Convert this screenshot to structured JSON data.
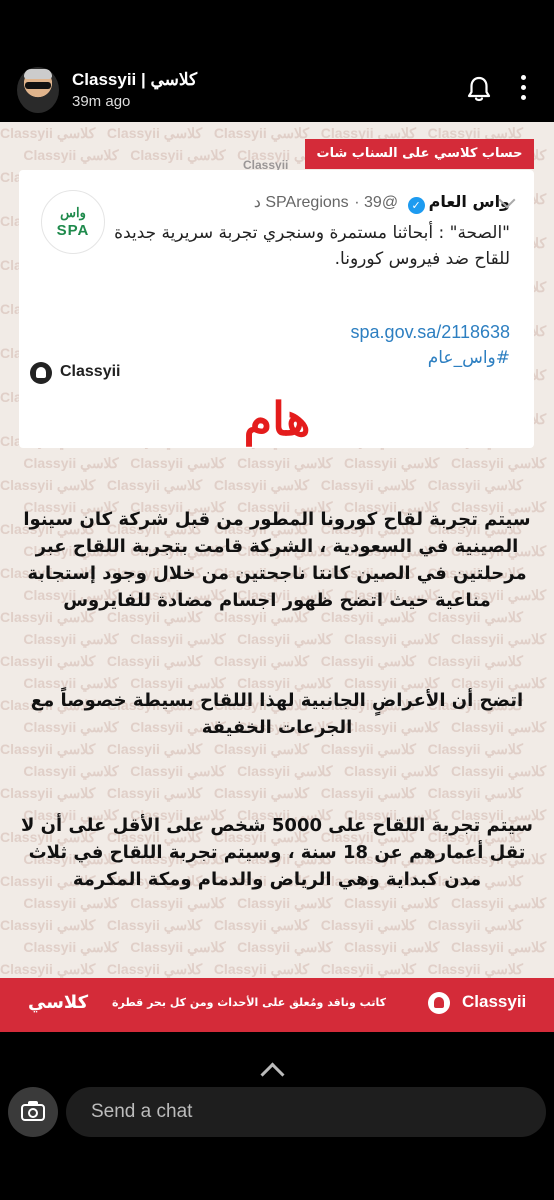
{
  "header": {
    "account_name": "Classyii | كلاسي",
    "time_ago": "39m ago"
  },
  "snap": {
    "watermark_text": "Classyii كلاسي",
    "ribbon": "حساب كلاسي على السناب شات",
    "watermark_inline": "Classyii",
    "tweet": {
      "name": "واس العام",
      "handle": "@SPAregions",
      "time": "39 د",
      "logo_top": "واس",
      "logo_bottom": "SPA",
      "body": "\"الصحة\" : أبحاثنا مستمرة وسنجري تجربة سريرية جديدة للقاح ضد فيروس كورونا.",
      "link": "spa.gov.sa/2118638",
      "hashtag": "#واس_عام"
    },
    "brand_name": "Classyii",
    "headline": "هام",
    "paragraph1": "سيتم تجربة لقاح كورونا المطور من قبل شركة كان سينوا الصينية في السعودية ، الشركة قامت بتجربة اللقاح عبر مرحلتين في الصين كانتا ناجحتين من خلال وجود إستجابة مناعية حيث اتضح ظهور اجسام مضادة للفايروس",
    "paragraph2": "اتضح أن الأعراضٍ الجانبية لهذا اللقاح بسيطة خصوصاً مع الجرعات الخفيفة",
    "paragraph3": "سيتم تجربة اللقاح على 5000 شخص على الأقل على أن لا تقل أعمارهم عن 18 سنة ، وسيتم تجربة اللقاح في ثلاث مدن كبداية وهي الرياض والدمام ومكة المكرمة",
    "footer": {
      "brand": "Classyii",
      "tagline": "كاتب وناقد ومُعلق على الأحداث ومن كل بحر قطرة",
      "arabic_brand": "كلاسي"
    }
  },
  "chat": {
    "placeholder": "Send a chat"
  },
  "icons": {
    "bell": "bell-icon",
    "more": "more-vertical-icon",
    "camera": "camera-icon",
    "swipe_up": "chevron-up-icon"
  }
}
